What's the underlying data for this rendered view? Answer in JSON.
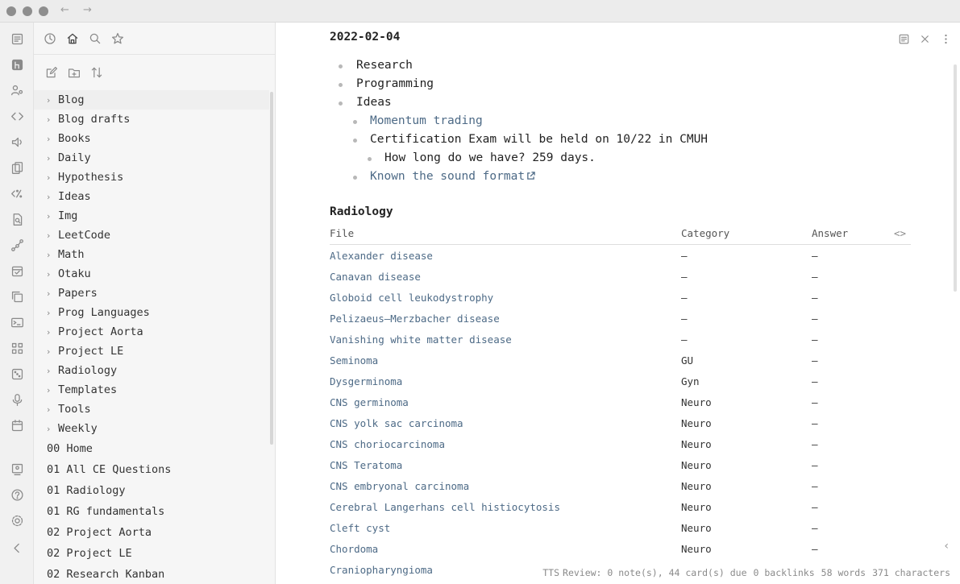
{
  "window": {
    "back": "←",
    "forward": "→"
  },
  "ribbon": {
    "icons": [
      "files-icon",
      "hub-icon",
      "graph-person-icon",
      "code-icon",
      "speaker-icon",
      "flashcards-icon",
      "percent-icon",
      "search-file-icon",
      "graph-icon",
      "calendar-check-icon",
      "copy-icon",
      "terminal-icon",
      "apps-icon",
      "dice-icon",
      "microphone-icon",
      "calendar-icon",
      "vault-icon",
      "help-icon",
      "settings-icon",
      "collapse-icon"
    ]
  },
  "sidebar": {
    "tabs": [
      "recent-icon",
      "home-icon",
      "search-icon",
      "star-icon"
    ],
    "actions": [
      "new-note-icon",
      "new-folder-icon",
      "sort-icon"
    ],
    "folders": [
      "Blog",
      "Blog drafts",
      "Books",
      "Daily",
      "Hypothesis",
      "Ideas",
      "Img",
      "LeetCode",
      "Math",
      "Otaku",
      "Papers",
      "Prog Languages",
      "Project Aorta",
      "Project LE",
      "Radiology",
      "Templates",
      "Tools",
      "Weekly"
    ],
    "files": [
      "00 Home",
      "01 All CE Questions",
      "01 Radiology",
      "01 RG fundamentals",
      "02 Project Aorta",
      "02 Project LE",
      "02 Research Kanban"
    ]
  },
  "note": {
    "title": "2022-02-04",
    "bullets": [
      {
        "level": 0,
        "text": "Research",
        "link": false
      },
      {
        "level": 0,
        "text": "Programming",
        "link": false
      },
      {
        "level": 0,
        "text": "Ideas",
        "link": false
      },
      {
        "level": 1,
        "text": "Momentum trading",
        "link": true
      },
      {
        "level": 1,
        "text": "Certification Exam will be held on 10/22 in CMUH",
        "link": false
      },
      {
        "level": 2,
        "text": "How long do we have? 259 days.",
        "link": false
      },
      {
        "level": 1,
        "text": "Known the sound format",
        "link": true,
        "external": true
      }
    ],
    "section": "Radiology",
    "table": {
      "headers": {
        "file": "File",
        "category": "Category",
        "answer": "Answer",
        "code": "<>"
      },
      "rows": [
        {
          "file": "Alexander disease",
          "category": "–",
          "answer": "–"
        },
        {
          "file": "Canavan disease",
          "category": "–",
          "answer": "–"
        },
        {
          "file": "Globoid cell leukodystrophy",
          "category": "–",
          "answer": "–"
        },
        {
          "file": "Pelizaeus–Merzbacher disease",
          "category": "–",
          "answer": "–"
        },
        {
          "file": "Vanishing white matter disease",
          "category": "–",
          "answer": "–"
        },
        {
          "file": "Seminoma",
          "category": "GU",
          "answer": "–"
        },
        {
          "file": "Dysgerminoma",
          "category": "Gyn",
          "answer": "–"
        },
        {
          "file": "CNS germinoma",
          "category": "Neuro",
          "answer": "–"
        },
        {
          "file": "CNS yolk sac carcinoma",
          "category": "Neuro",
          "answer": "–"
        },
        {
          "file": "CNS choriocarcinoma",
          "category": "Neuro",
          "answer": "–"
        },
        {
          "file": "CNS Teratoma",
          "category": "Neuro",
          "answer": "–"
        },
        {
          "file": "CNS embryonal carcinoma",
          "category": "Neuro",
          "answer": "–"
        },
        {
          "file": "Cerebral Langerhans cell histiocytosis",
          "category": "Neuro",
          "answer": "–"
        },
        {
          "file": "Cleft cyst",
          "category": "Neuro",
          "answer": "–"
        },
        {
          "file": "Chordoma",
          "category": "Neuro",
          "answer": "–"
        },
        {
          "file": "Craniopharyngioma",
          "category": "",
          "answer": ""
        }
      ]
    }
  },
  "statusbar": {
    "tts": "TTS",
    "review": "Review: 0 note(s), 44 card(s) due",
    "backlinks": "0 backlinks",
    "words": "58 words",
    "characters": "371 characters"
  },
  "colors": {
    "link": "#4d6a86",
    "sidebar_bg": "#f6f6f6",
    "ribbon_bg": "#f1f1f1"
  }
}
